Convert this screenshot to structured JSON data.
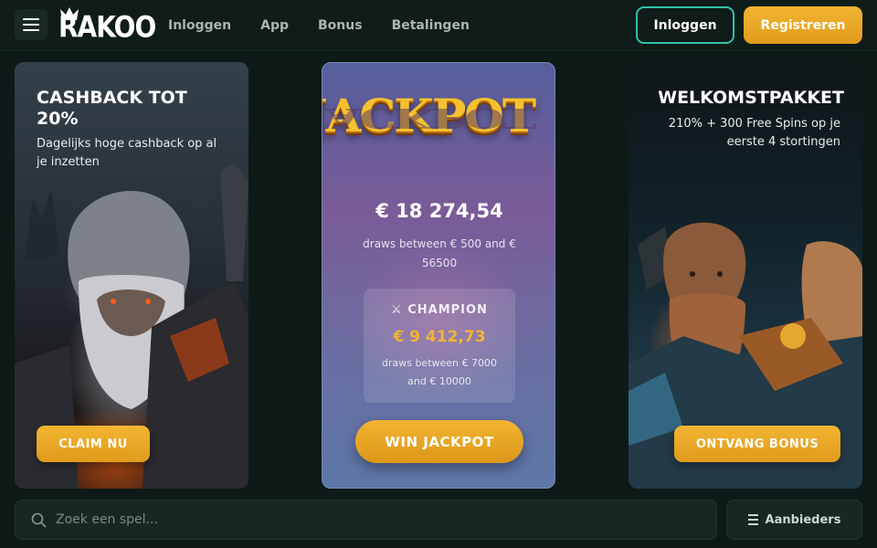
{
  "header": {
    "logo_text": "RAKOO",
    "nav": [
      "Inloggen",
      "App",
      "Bonus",
      "Betalingen"
    ],
    "login_label": "Inloggen",
    "register_label": "Registreren"
  },
  "promo_left": {
    "title": "CASHBACK TOT 20%",
    "subtitle": "Dagelijks hoge cashback op al je inzetten",
    "button": "CLAIM NU"
  },
  "promo_middle": {
    "banner_word": "JACKPOT",
    "amount": "€ 18 274,54",
    "range": "draws between € 500 and € 56500",
    "champion_label": "⚔ CHAMPION",
    "champion_amount": "€ 9 412,73",
    "champion_range": "draws between € 7000 and € 10000",
    "button": "WIN JACKPOT"
  },
  "promo_right": {
    "title": "WELKOMSTPAKKET",
    "subtitle": "210% + 300 Free Spins op je eerste 4 stortingen",
    "button": "ONTVANG BONUS"
  },
  "search": {
    "placeholder": "Zoek een spel..."
  },
  "providers_label": "Aanbieders",
  "colors": {
    "accent_gold": "#f2b532",
    "accent_teal": "#2fc2a9",
    "background": "#0d1a17"
  }
}
